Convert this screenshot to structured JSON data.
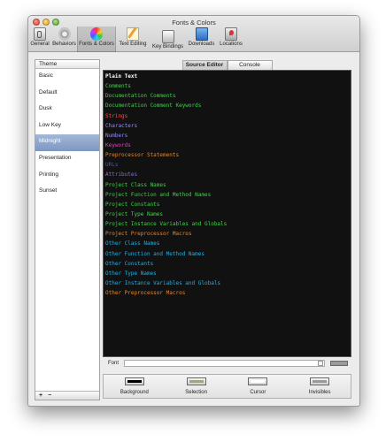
{
  "window": {
    "title": "Fonts & Colors"
  },
  "toolbar": {
    "items": [
      {
        "label": "General",
        "icon": "general-icon"
      },
      {
        "label": "Behaviors",
        "icon": "gear-icon"
      },
      {
        "label": "Fonts & Colors",
        "icon": "color-wheel-icon",
        "selected": true
      },
      {
        "label": "Text Editing",
        "icon": "pencil-icon"
      },
      {
        "label": "Key Bindings",
        "icon": "keyboard-icon"
      },
      {
        "label": "Downloads",
        "icon": "download-icon"
      },
      {
        "label": "Locations",
        "icon": "location-icon"
      }
    ]
  },
  "sidebar": {
    "header": "Theme",
    "items": [
      "Basic",
      "Default",
      "Dusk",
      "Low Key",
      "Midnight",
      "Presentation",
      "Printing",
      "Sunset"
    ],
    "selected": "Midnight",
    "add_label": "+",
    "remove_label": "−"
  },
  "tabs": {
    "source_editor": "Source Editor",
    "console": "Console",
    "active": "Source Editor"
  },
  "editor": {
    "background": "#111111",
    "rows": [
      {
        "text": "Plain Text",
        "color": "#ffffff",
        "bold": true
      },
      {
        "text": "Comments",
        "color": "#3fd24a"
      },
      {
        "text": "Documentation Comments",
        "color": "#3fd24a"
      },
      {
        "text": "Documentation Comment Keywords",
        "color": "#3fd24a"
      },
      {
        "text": "Strings",
        "color": "#ff4a4a"
      },
      {
        "text": "Characters",
        "color": "#8f8cff"
      },
      {
        "text": "Numbers",
        "color": "#8f8cff"
      },
      {
        "text": "Keywords",
        "color": "#e83cc7"
      },
      {
        "text": "Preprocessor Statements",
        "color": "#e8862a"
      },
      {
        "text": "URLs",
        "color": "#4a48ff"
      },
      {
        "text": "Attributes",
        "color": "#7f74c8"
      },
      {
        "text": "Project Class Names",
        "color": "#3fd24a"
      },
      {
        "text": "Project Function and Method Names",
        "color": "#3fd24a"
      },
      {
        "text": "Project Constants",
        "color": "#3fd24a"
      },
      {
        "text": "Project Type Names",
        "color": "#3fd24a"
      },
      {
        "text": "Project Instance Variables and Globals",
        "color": "#3fd24a"
      },
      {
        "text": "Project Preprocessor Macros",
        "color": "#e8862a"
      },
      {
        "text": "Other Class Names",
        "color": "#1fb2ea"
      },
      {
        "text": "Other Function and Method Names",
        "color": "#1fb2ea"
      },
      {
        "text": "Other Constants",
        "color": "#1fb2ea"
      },
      {
        "text": "Other Type Names",
        "color": "#1fb2ea"
      },
      {
        "text": "Other Instance Variables and Globals",
        "color": "#1fb2ea"
      },
      {
        "text": "Other Preprocessor Macros",
        "color": "#e8862a"
      }
    ]
  },
  "font": {
    "label": "Font",
    "value": ""
  },
  "swatches": [
    {
      "label": "Background",
      "color": "#000000"
    },
    {
      "label": "Selection",
      "color": "#a3a38a"
    },
    {
      "label": "Cursor",
      "color": "#ffffff"
    },
    {
      "label": "Invisibles",
      "color": "#9a9a9a"
    }
  ]
}
